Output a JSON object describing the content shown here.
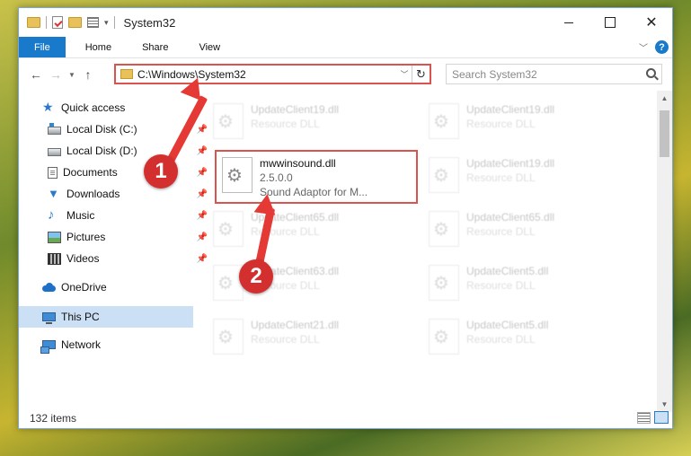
{
  "window": {
    "title": "System32"
  },
  "ribbon": {
    "tabs": [
      "File",
      "Home",
      "Share",
      "View"
    ]
  },
  "address": {
    "path": "C:\\Windows\\System32"
  },
  "search": {
    "placeholder": "Search System32"
  },
  "nav": {
    "quick_access": "Quick access",
    "items": [
      {
        "label": "Local Disk (C:)",
        "pinned": true
      },
      {
        "label": "Local Disk (D:)",
        "pinned": true
      },
      {
        "label": "Documents",
        "pinned": true
      },
      {
        "label": "Downloads",
        "pinned": true
      },
      {
        "label": "Music",
        "pinned": true
      },
      {
        "label": "Pictures",
        "pinned": true
      },
      {
        "label": "Videos",
        "pinned": true
      }
    ],
    "onedrive": "OneDrive",
    "this_pc": "This PC",
    "network": "Network"
  },
  "files": {
    "highlighted": {
      "name": "mwwinsound.dll",
      "version": "2.5.0.0",
      "description": "Sound Adaptor for M..."
    },
    "left_column": [
      {
        "name": "UpdateClient19.dll",
        "sub": "Resource DLL"
      },
      {
        "name": "UpdateClient65.dll",
        "sub": "Resource DLL"
      },
      {
        "name": "UpdateClient63.dll",
        "sub": "Resource DLL"
      },
      {
        "name": "UpdateClient21.dll",
        "sub": "Resource DLL"
      }
    ],
    "right_column": [
      {
        "name": "UpdateClient19.dll",
        "sub": "Resource DLL"
      },
      {
        "name": "UpdateClient19.dll",
        "sub": "Resource DLL"
      },
      {
        "name": "UpdateClient65.dll",
        "sub": "Resource DLL"
      },
      {
        "name": "UpdateClient5.dll",
        "sub": "Resource DLL"
      },
      {
        "name": "UpdateClient5.dll",
        "sub": "Resource DLL"
      }
    ]
  },
  "status": {
    "items": "132 items"
  },
  "annotations": {
    "step1": "1",
    "step2": "2",
    "color": "#d32f2f"
  }
}
